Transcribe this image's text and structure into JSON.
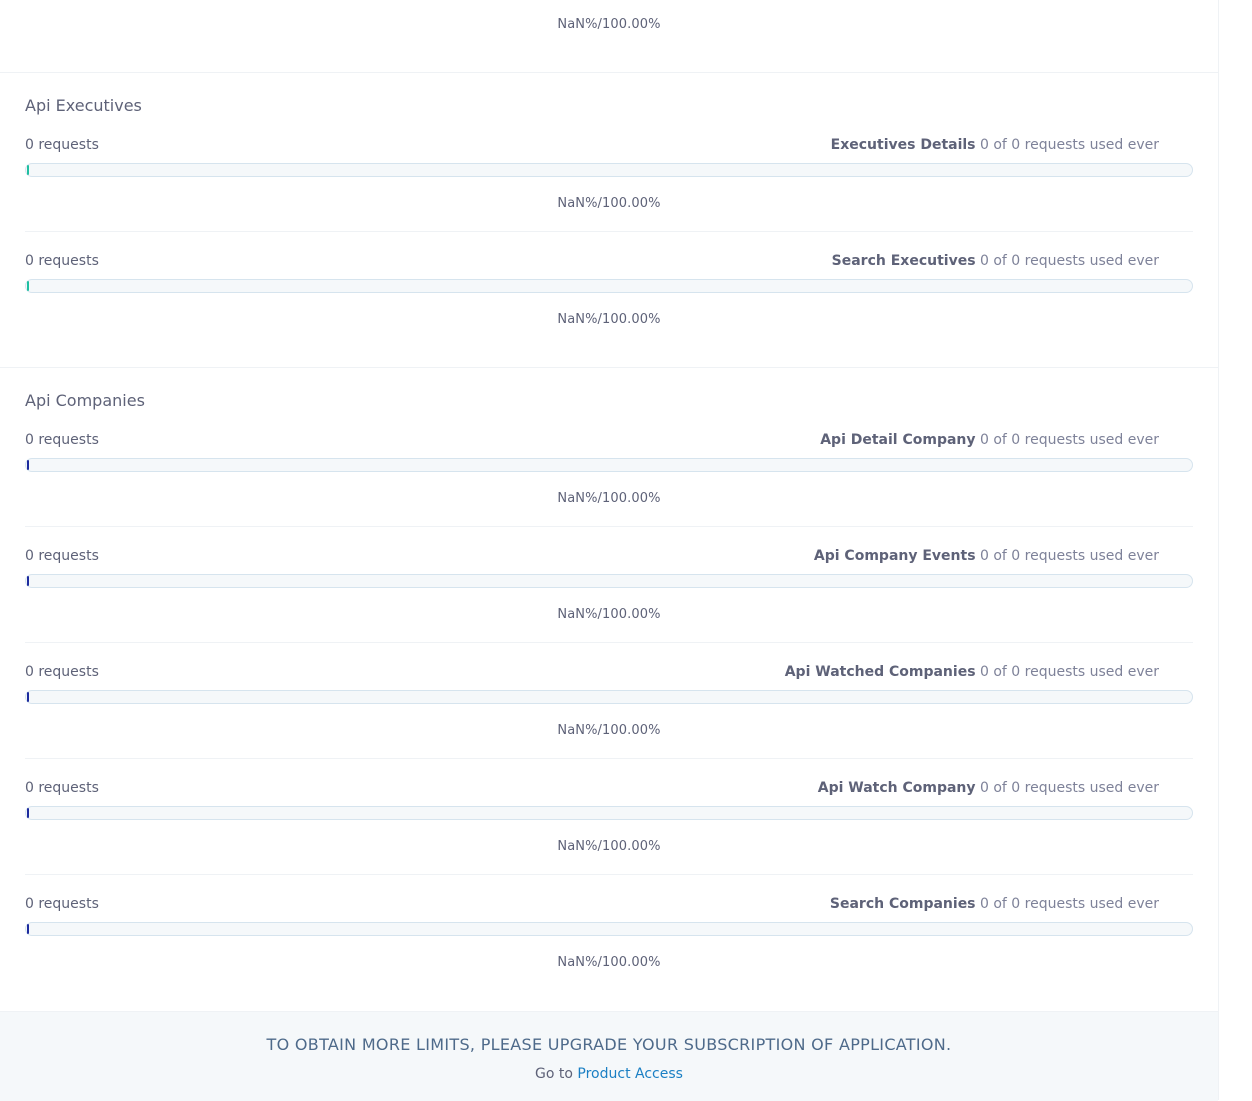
{
  "top_percent": "NaN%/100.00%",
  "colors": {
    "executives_bar": "#1fbfa1",
    "companies_bar": "#1d2b9e",
    "link": "#1a7fc4"
  },
  "sections": [
    {
      "title": "Api Executives",
      "rows": [
        {
          "left": "0 requests",
          "name": "Executives Details",
          "usage": "0 of 0 requests used ever",
          "percent": "NaN%/100.00%"
        },
        {
          "left": "0 requests",
          "name": "Search Executives",
          "usage": "0 of 0 requests used ever",
          "percent": "NaN%/100.00%"
        }
      ]
    },
    {
      "title": "Api Companies",
      "rows": [
        {
          "left": "0 requests",
          "name": "Api Detail Company",
          "usage": "0 of 0 requests used ever",
          "percent": "NaN%/100.00%"
        },
        {
          "left": "0 requests",
          "name": "Api Company Events",
          "usage": "0 of 0 requests used ever",
          "percent": "NaN%/100.00%"
        },
        {
          "left": "0 requests",
          "name": "Api Watched Companies",
          "usage": "0 of 0 requests used ever",
          "percent": "NaN%/100.00%"
        },
        {
          "left": "0 requests",
          "name": "Api Watch Company",
          "usage": "0 of 0 requests used ever",
          "percent": "NaN%/100.00%"
        },
        {
          "left": "0 requests",
          "name": "Search Companies",
          "usage": "0 of 0 requests used ever",
          "percent": "NaN%/100.00%"
        }
      ]
    }
  ],
  "footer": {
    "message": "TO OBTAIN MORE LIMITS, PLEASE UPGRADE YOUR SUBSCRIPTION OF APPLICATION.",
    "goto_prefix": "Go to",
    "link_label": "Product Access"
  }
}
